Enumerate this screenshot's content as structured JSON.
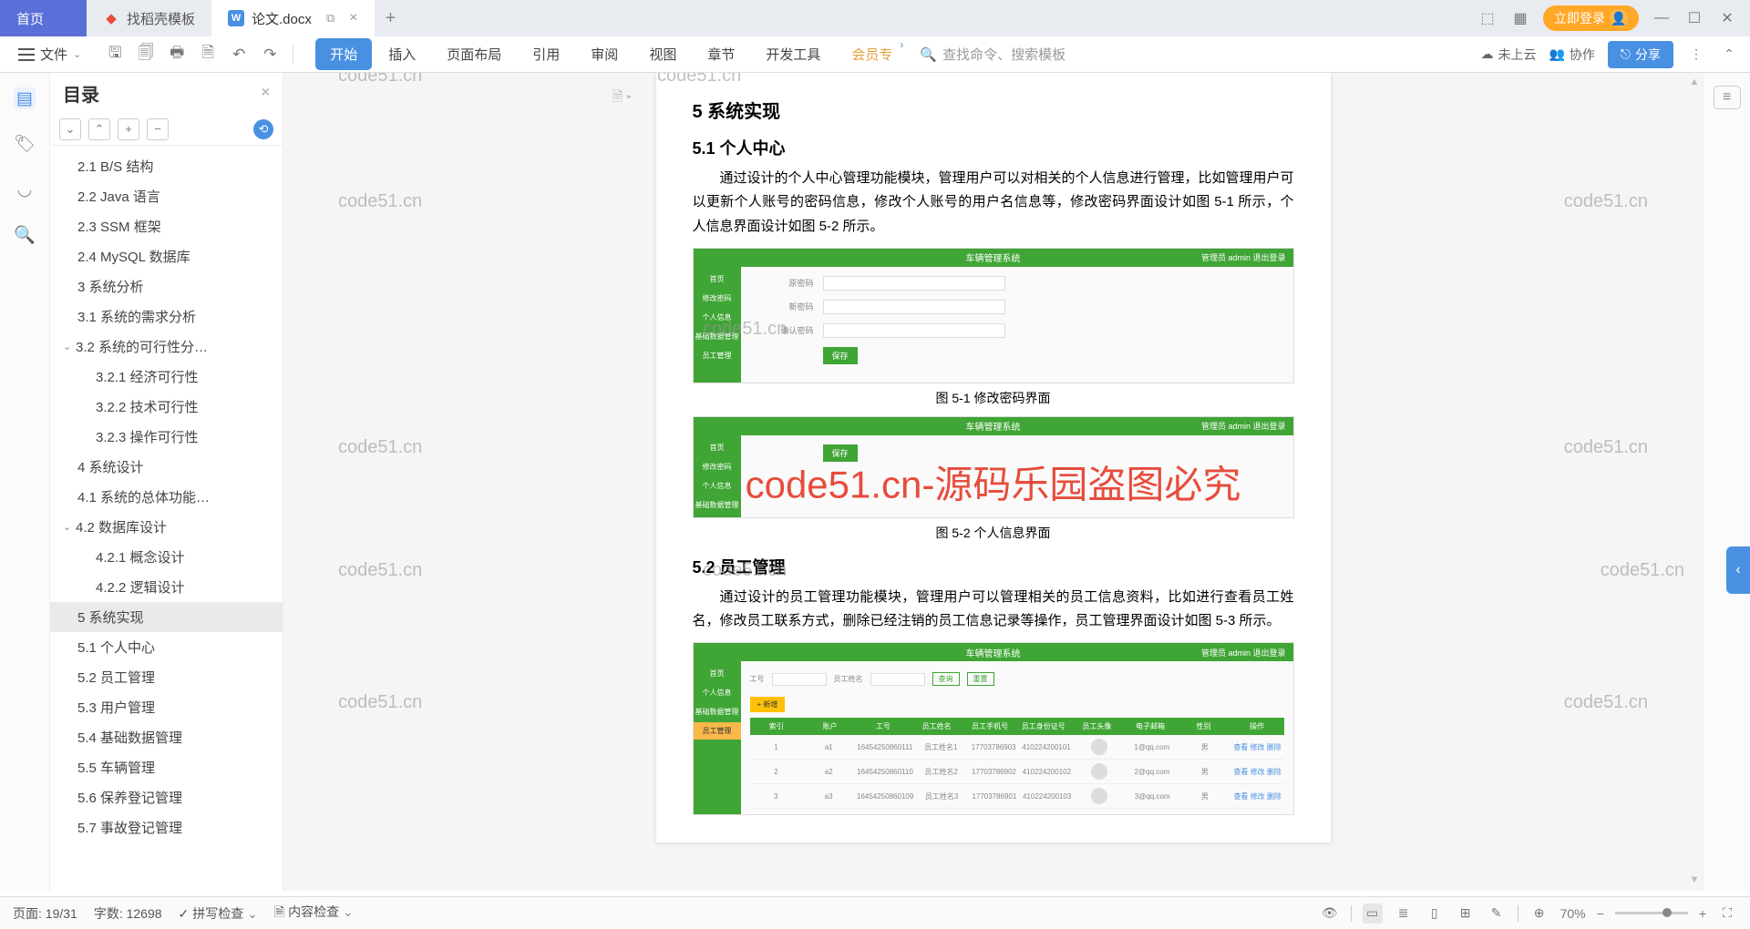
{
  "tabs": {
    "home": "首页",
    "t1": "找稻壳模板",
    "t2": "论文.docx"
  },
  "login_btn": "立即登录",
  "ribbon": {
    "file": "文件",
    "items": [
      "开始",
      "插入",
      "页面布局",
      "引用",
      "审阅",
      "视图",
      "章节",
      "开发工具",
      "会员专"
    ],
    "search_ph": "查找命令、搜索模板",
    "cloud": "未上云",
    "coop": "协作",
    "share": "分享"
  },
  "outline": {
    "title": "目录",
    "items": [
      {
        "t": "2.1 B/S 结构",
        "l": 2
      },
      {
        "t": "2.2 Java 语言",
        "l": 2
      },
      {
        "t": "2.3 SSM 框架",
        "l": 2
      },
      {
        "t": "2.4 MySQL 数据库",
        "l": 2
      },
      {
        "t": "3 系统分析",
        "l": 1
      },
      {
        "t": "3.1 系统的需求分析",
        "l": 2
      },
      {
        "t": "3.2 系统的可行性分…",
        "l": 2,
        "chev": true
      },
      {
        "t": "3.2.1 经济可行性",
        "l": 3
      },
      {
        "t": "3.2.2 技术可行性",
        "l": 3
      },
      {
        "t": "3.2.3 操作可行性",
        "l": 3
      },
      {
        "t": "4 系统设计",
        "l": 1
      },
      {
        "t": "4.1 系统的总体功能…",
        "l": 2
      },
      {
        "t": "4.2 数据库设计",
        "l": 2,
        "chev": true
      },
      {
        "t": "4.2.1 概念设计",
        "l": 3
      },
      {
        "t": "4.2.2 逻辑设计",
        "l": 3
      },
      {
        "t": "5 系统实现",
        "l": 1,
        "sel": true
      },
      {
        "t": "5.1 个人中心",
        "l": 2
      },
      {
        "t": "5.2 员工管理",
        "l": 2
      },
      {
        "t": "5.3 用户管理",
        "l": 2
      },
      {
        "t": "5.4 基础数据管理",
        "l": 2
      },
      {
        "t": "5.5 车辆管理",
        "l": 2
      },
      {
        "t": "5.6 保养登记管理",
        "l": 2
      },
      {
        "t": "5.7 事故登记管理",
        "l": 2
      }
    ]
  },
  "doc": {
    "h5": "5 系统实现",
    "h51": "5.1 个人中心",
    "p51": "通过设计的个人中心管理功能模块，管理用户可以对相关的个人信息进行管理，比如管理用户可以更新个人账号的密码信息，修改个人账号的用户名信息等，修改密码界面设计如图 5-1 所示，个人信息界面设计如图 5-2 所示。",
    "c51": "图 5-1 修改密码界面",
    "c52": "图 5-2 个人信息界面",
    "h52": "5.2 员工管理",
    "p52": "通过设计的员工管理功能模块，管理用户可以管理相关的员工信息资料，比如进行查看员工姓名，修改员工联系方式，删除已经注销的员工信息记录等操作，员工管理界面设计如图 5-3 所示。",
    "sys_title": "车辆管理系统",
    "sys_right": "管理员 admin    退出登录",
    "side_items": [
      "首页",
      "修改密码",
      "个人信息",
      "基础数据管理",
      "员工管理"
    ],
    "f1_labels": [
      "原密码",
      "新密码",
      "确认密码"
    ],
    "f1_btn": "保存",
    "tbl_hdr": [
      "索引",
      "账户",
      "工号",
      "员工姓名",
      "员工手机号",
      "员工身份证号",
      "员工头像",
      "电子邮箱",
      "性别",
      "操作"
    ],
    "add_btn": "+ 新增",
    "filter_labels": [
      "工号",
      "员工姓名",
      "查询",
      "重置"
    ],
    "rows": [
      {
        "i": "1",
        "a": "a1",
        "g": "16454250860111",
        "n": "员工姓名1",
        "p": "17703786903",
        "id": "410224200101",
        "e": "1@qq.com",
        "s": "男"
      },
      {
        "i": "2",
        "a": "a2",
        "g": "16454250860110",
        "n": "员工姓名2",
        "p": "17703786902",
        "id": "410224200102",
        "e": "2@qq.com",
        "s": "男"
      },
      {
        "i": "3",
        "a": "a3",
        "g": "16454250860109",
        "n": "员工姓名3",
        "p": "17703786901",
        "id": "410224200103",
        "e": "3@qq.com",
        "s": "男"
      }
    ],
    "row_ops": "查看 修改 删除"
  },
  "status": {
    "page": "页面: 19/31",
    "words": "字数: 12698",
    "spell": "拼写检查",
    "check": "内容检查",
    "zoom": "70%"
  },
  "watermark": "code51.cn",
  "watermark_big": "code51.cn-源码乐园盗图必究"
}
